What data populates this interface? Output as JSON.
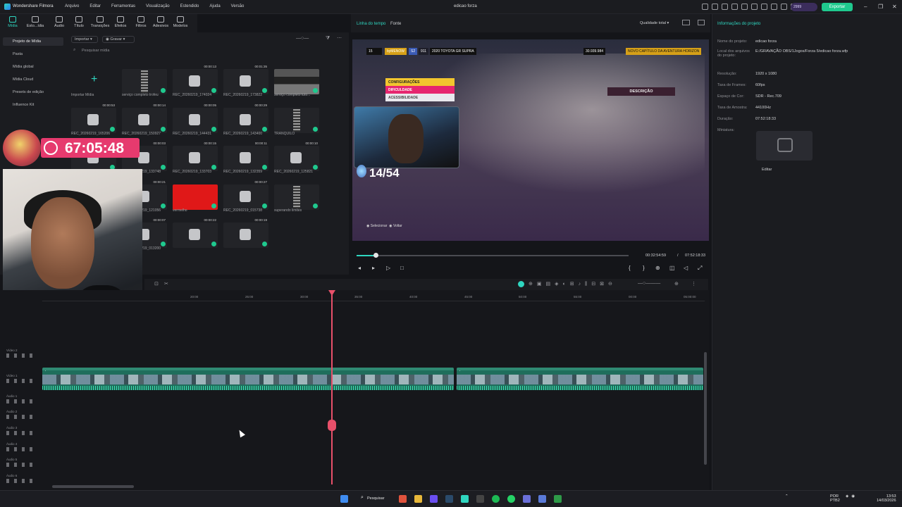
{
  "titlebar": {
    "app_name": "Wondershare Filmora",
    "menu": [
      "Arquivo",
      "Editar",
      "Ferramentas",
      "Visualização",
      "Estendido",
      "Ajuda",
      "Versão"
    ],
    "project_title": "edicao forza",
    "credits": "2999",
    "export_label": "Exportar",
    "accent": "#1fc98e"
  },
  "media_tabs": [
    "Mídia",
    "Esto...ídia",
    "Áudio",
    "Título",
    "Transições",
    "Efeitos",
    "Filtros",
    "Adesivos",
    "Modelos"
  ],
  "tree": {
    "items": [
      "Projeto de Mídia",
      "Pasta",
      "Mídia global",
      "Mídia Cloud",
      "Presets de edição",
      "Influence Kit"
    ]
  },
  "media": {
    "import_label": "Importar",
    "record_label": "Gravar",
    "search_placeholder": "Pesquisar mídia",
    "items": [
      {
        "label": "Importar Mídia",
        "dur": ""
      },
      {
        "label": "serviço completo trofeu",
        "dur": ""
      },
      {
        "label": "REC_20260219_174024",
        "dur": "00:00:13"
      },
      {
        "label": "REC_20260219_173822",
        "dur": "00:01:35"
      },
      {
        "label": "serviço completo tuto...",
        "dur": ""
      },
      {
        "label": "REC_20260219_165206",
        "dur": "00:00:53"
      },
      {
        "label": "REC_20260219_150927",
        "dur": "00:00:14"
      },
      {
        "label": "REC_20260219_144431",
        "dur": "00:00:05"
      },
      {
        "label": "REC_20260219_143400",
        "dur": "00:00:29"
      },
      {
        "label": "TRANQUILO",
        "dur": ""
      },
      {
        "label": "REC_20260219_133815",
        "dur": "00:00:05"
      },
      {
        "label": "REC_20260219_133748",
        "dur": "00:00:03"
      },
      {
        "label": "REC_20260219_133703",
        "dur": "00:00:15"
      },
      {
        "label": "REC_20260219_132359",
        "dur": "00:00:11"
      },
      {
        "label": "REC_20260219_125821",
        "dur": "00:00:10"
      },
      {
        "label": "REC_20260219_124812",
        "dur": "00:00:06"
      },
      {
        "label": "REC_20260219_121056",
        "dur": "00:00:21"
      },
      {
        "label": "vermelho",
        "dur": ""
      },
      {
        "label": "REC_20260219_015738",
        "dur": "00:00:27"
      },
      {
        "label": "superando limites",
        "dur": ""
      },
      {
        "label": "REC_20260219_013817",
        "dur": "00:00:08"
      },
      {
        "label": "REC_20260219_013200",
        "dur": "00:00:07"
      },
      {
        "label": "",
        "dur": "00:00:22"
      },
      {
        "label": "",
        "dur": "00:00:19"
      }
    ]
  },
  "overlay": {
    "timer": "67:05:48",
    "counter": "14/54"
  },
  "player": {
    "tab_timeline": "Linha do tempo",
    "tab_source": "Fonte",
    "quality": "Qualidade total",
    "hud": {
      "level": "15",
      "user": "byMENOW",
      "s2": "S2",
      "s2_value": "911",
      "car": "2020 TOYOTA GR SUPRA",
      "money": "30.939.984",
      "chapter": "NOVO CAPÍTULO DA AVENTURA HORIZON"
    },
    "menu": [
      "CONFIGURAÇÕES",
      "DIFICULDADE",
      "ACESSIBILIDADE"
    ],
    "description": "DESCRIÇÃO",
    "hint_select": "Selecionar",
    "hint_back": "Voltar",
    "current_time": "00:32:54:59",
    "separator": "/",
    "total_time": "07:52:18:33",
    "progress": 0.07
  },
  "info": {
    "title": "Informações do projeto",
    "rows": [
      {
        "label": "Nome do projeto:",
        "value": "edicao forza"
      },
      {
        "label": "Local dos arquivos do projeto:",
        "value": "E:/GRAVAÇÃO OBS/1Jogos/Forza 5/edicao forza.wfp"
      },
      {
        "label": "Resolução:",
        "value": "1920 x 1080"
      },
      {
        "label": "Taxa de Frames:",
        "value": "60fps"
      },
      {
        "label": "Espaço de Cor:",
        "value": "SDR - Rec.709"
      },
      {
        "label": "Taxa de Amostra:",
        "value": "44100Hz"
      },
      {
        "label": "Duração:",
        "value": "07:52:18:33"
      },
      {
        "label": "Miniatura:",
        "value": ""
      }
    ],
    "edit_label": "Editar"
  },
  "timeline": {
    "ticks": [
      "20:00",
      "25:00",
      "30:00",
      "35:00",
      "40:00",
      "45:00",
      "50:00",
      "55:00",
      "00:00",
      "05:00:00"
    ],
    "tracks": [
      "Vídeo 2",
      "Vídeo 1",
      "Áudio 1",
      "Áudio 2",
      "Áudio 3",
      "Áudio 4",
      "Áudio 5",
      "Áudio 6"
    ],
    "clips": [
      "p1",
      "p1"
    ]
  },
  "taskbar": {
    "search": "Pesquisar",
    "lang1": "POR",
    "lang2": "PTB2",
    "time": "13:53",
    "date": "14/03/2026"
  }
}
